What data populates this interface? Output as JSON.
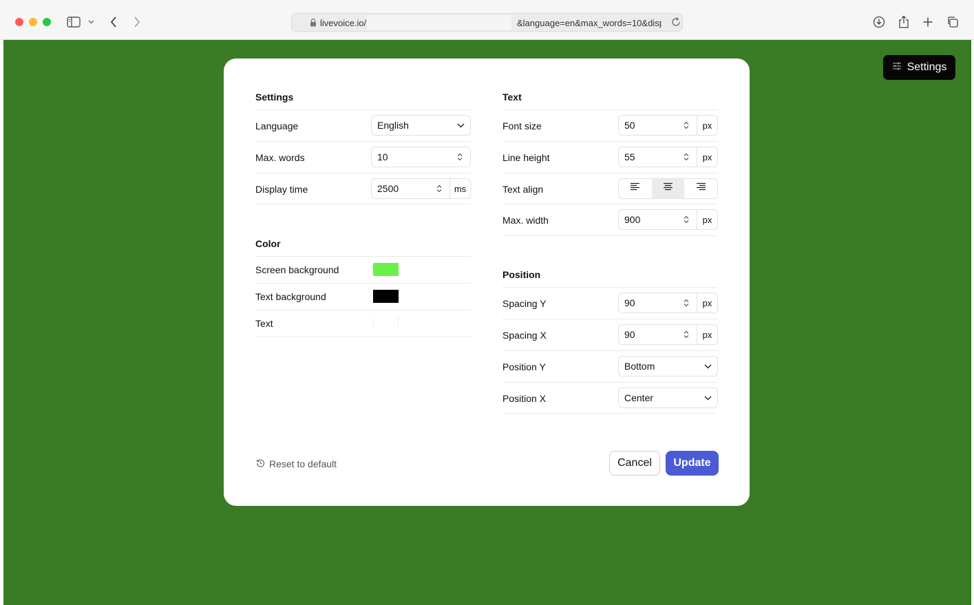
{
  "browser": {
    "url_host": "livevoice.io/",
    "url_query": "&language=en&max_words=10&disp"
  },
  "page": {
    "background_color": "#3a7b25",
    "settings_button_label": "Settings"
  },
  "modal": {
    "settings": {
      "title": "Settings",
      "language": {
        "label": "Language",
        "value": "English"
      },
      "max_words": {
        "label": "Max. words",
        "value": "10"
      },
      "display_time": {
        "label": "Display time",
        "value": "2500",
        "unit": "ms"
      }
    },
    "color": {
      "title": "Color",
      "screen_background": {
        "label": "Screen background",
        "color": "#6bf04a"
      },
      "text_background": {
        "label": "Text background",
        "color": "#000000"
      },
      "text": {
        "label": "Text",
        "color": "#ffffff"
      }
    },
    "text": {
      "title": "Text",
      "font_size": {
        "label": "Font size",
        "value": "50",
        "unit": "px"
      },
      "line_height": {
        "label": "Line height",
        "value": "55",
        "unit": "px"
      },
      "text_align": {
        "label": "Text align",
        "options": [
          "left",
          "center",
          "right"
        ],
        "selected": "center"
      },
      "max_width": {
        "label": "Max. width",
        "value": "900",
        "unit": "px"
      }
    },
    "position": {
      "title": "Position",
      "spacing_y": {
        "label": "Spacing Y",
        "value": "90",
        "unit": "px"
      },
      "spacing_x": {
        "label": "Spacing X",
        "value": "90",
        "unit": "px"
      },
      "position_y": {
        "label": "Position Y",
        "value": "Bottom"
      },
      "position_x": {
        "label": "Position X",
        "value": "Center"
      }
    },
    "footer": {
      "reset_label": "Reset to default",
      "cancel_label": "Cancel",
      "update_label": "Update",
      "update_color": "#4a5bd5"
    }
  }
}
